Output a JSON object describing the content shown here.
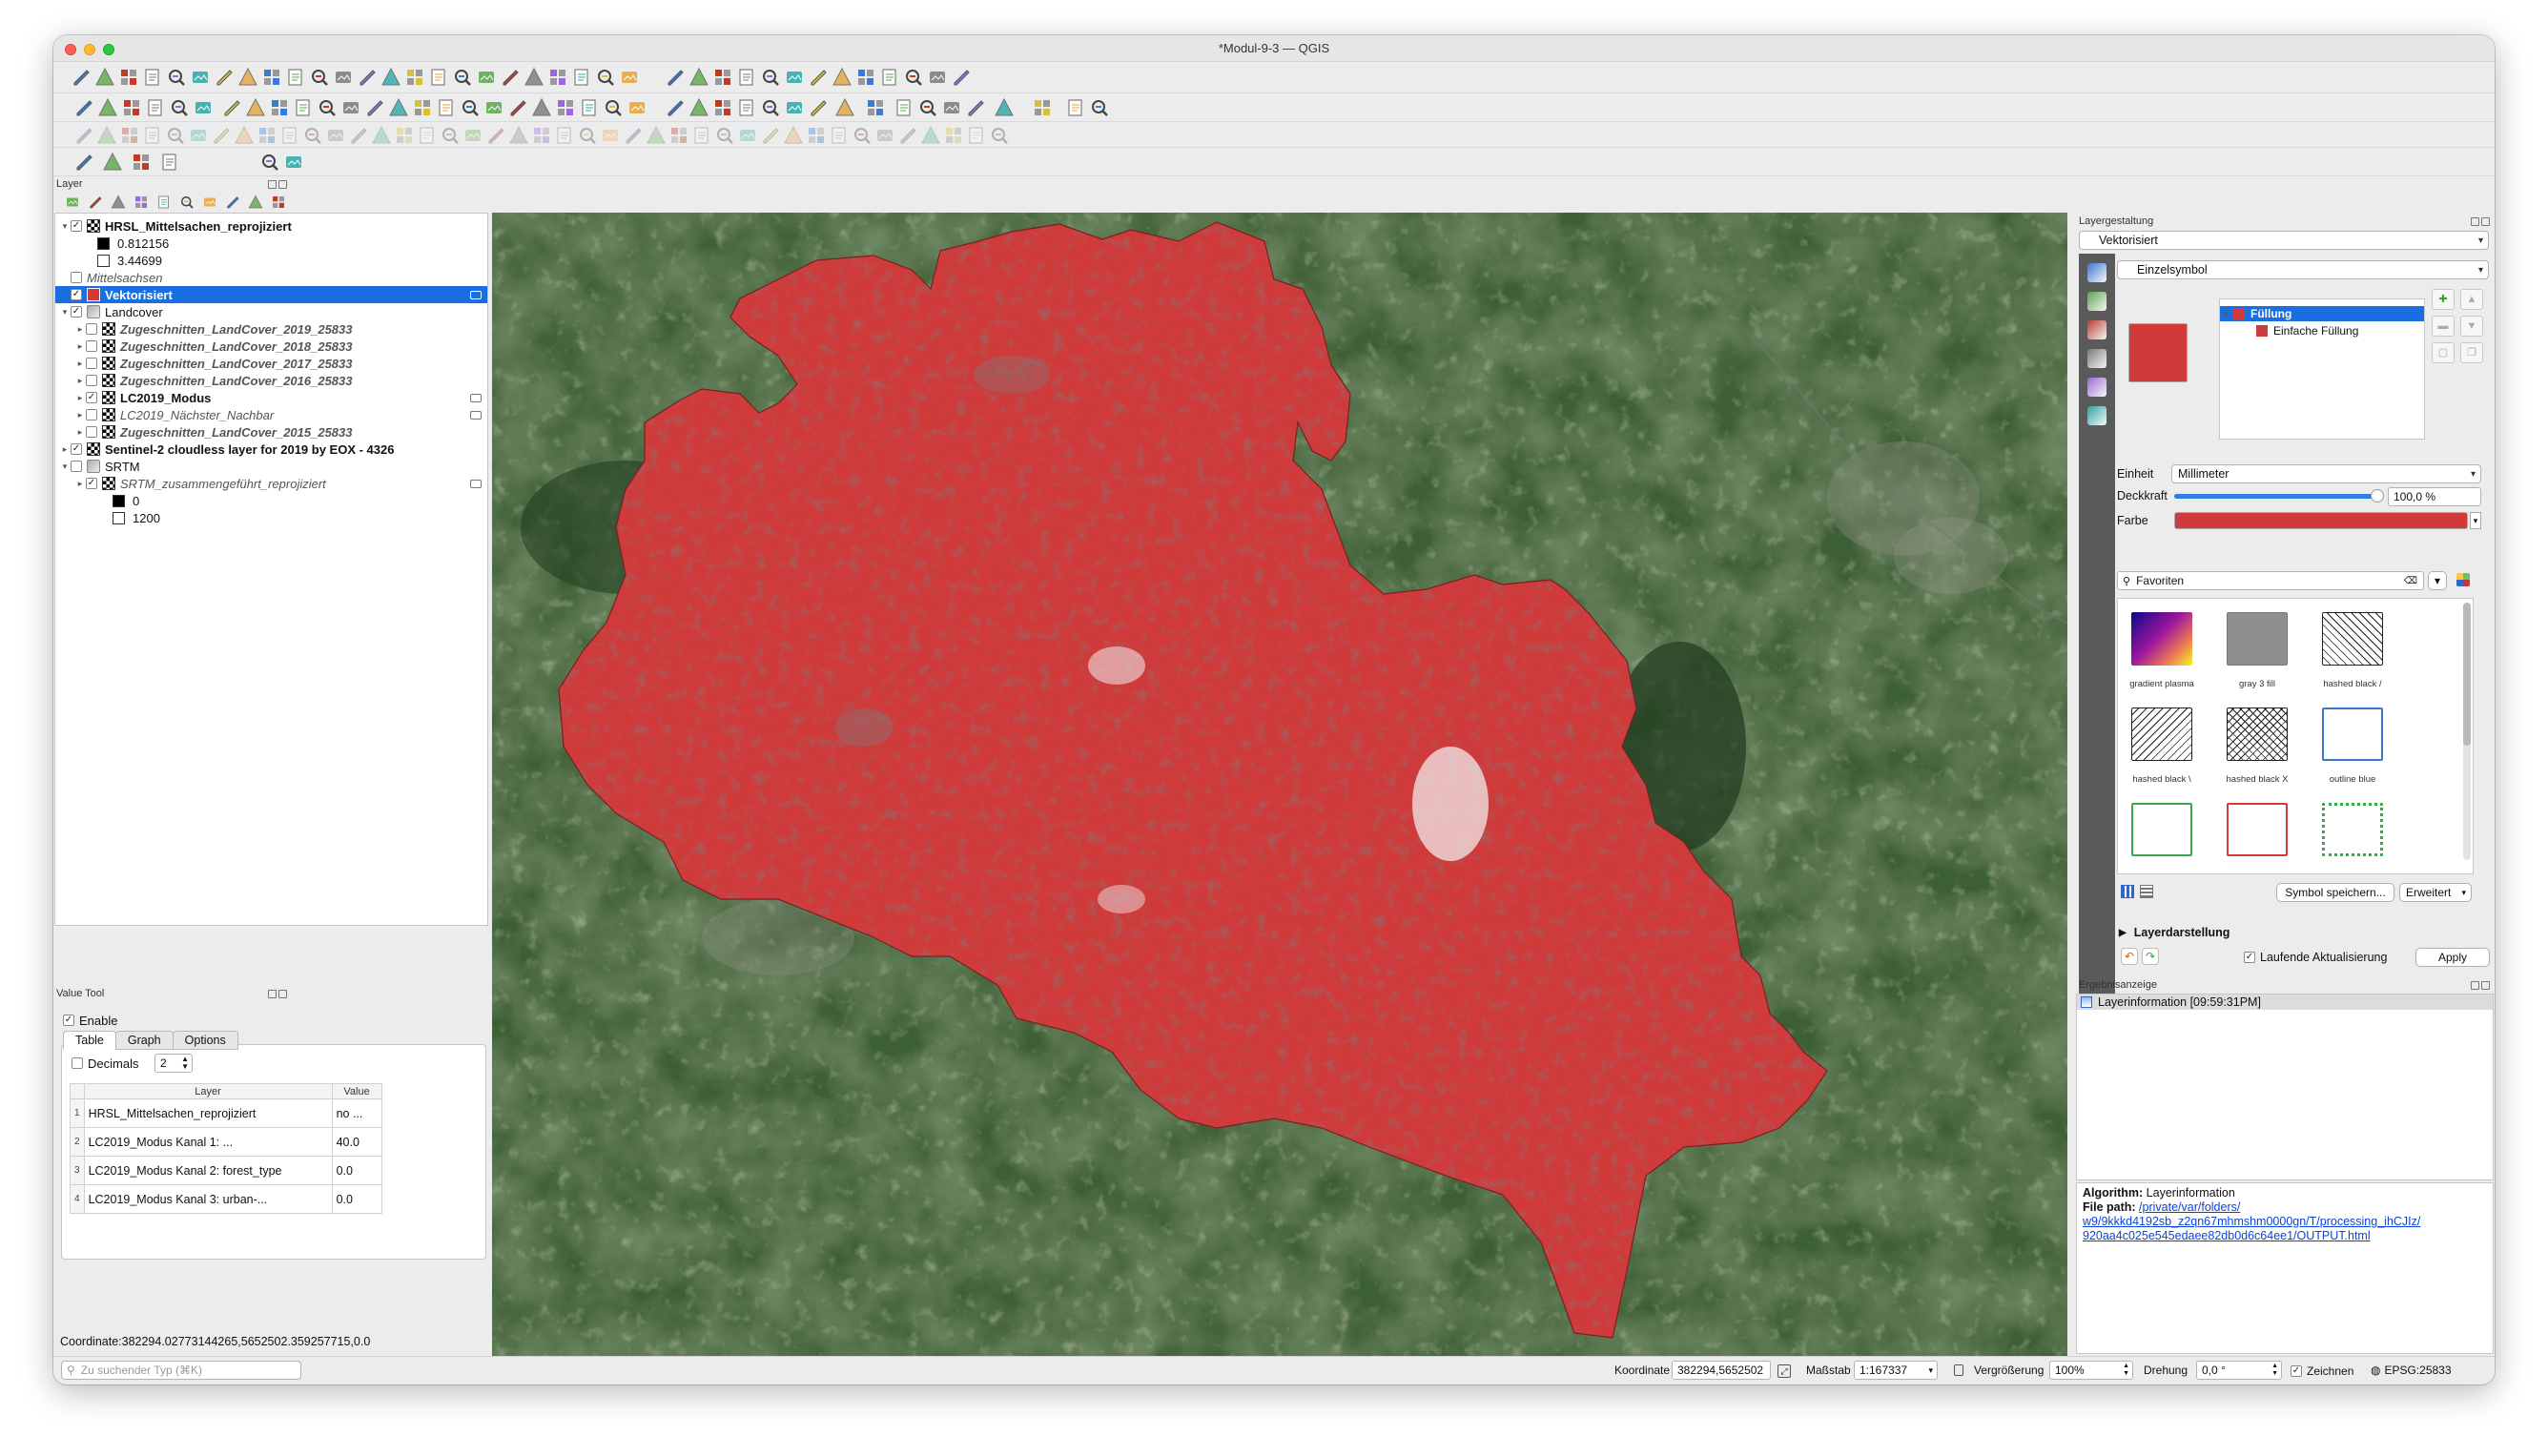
{
  "window": {
    "title": "*Modul-9-3 — QGIS"
  },
  "layers_panel": {
    "title": "Layer",
    "items": [
      {
        "label": "HRSL_Mittelsachen_reprojiziert",
        "style": "bold",
        "checked": true,
        "expanded": true,
        "icon": "raster"
      },
      {
        "label": "0.812156",
        "style": "legend",
        "swatch": "#000000"
      },
      {
        "label": "3.44699",
        "style": "legend",
        "swatch": "#ffffff"
      },
      {
        "label": "Mittelsachsen",
        "style": "italic",
        "checked": false,
        "icon": "none"
      },
      {
        "label": "Vektorisiert",
        "style": "bold",
        "checked": true,
        "selected": true,
        "icon": "polygon"
      },
      {
        "label": "Landcover",
        "style": "group",
        "checked": true,
        "expanded": true,
        "icon": "group"
      },
      {
        "label": "Zugeschnitten_LandCover_2019_25833",
        "style": "italic-bold",
        "checked": false,
        "icon": "raster"
      },
      {
        "label": "Zugeschnitten_LandCover_2018_25833",
        "style": "italic-bold",
        "checked": false,
        "icon": "raster"
      },
      {
        "label": "Zugeschnitten_LandCover_2017_25833",
        "style": "italic-bold",
        "checked": false,
        "icon": "raster"
      },
      {
        "label": "Zugeschnitten_LandCover_2016_25833",
        "style": "italic-bold",
        "checked": false,
        "icon": "raster"
      },
      {
        "label": "LC2019_Modus",
        "style": "bold",
        "checked": true,
        "icon": "raster"
      },
      {
        "label": "LC2019_Nächster_Nachbar",
        "style": "italic",
        "checked": false,
        "icon": "raster"
      },
      {
        "label": "Zugeschnitten_LandCover_2015_25833",
        "style": "italic-bold",
        "checked": false,
        "icon": "raster"
      },
      {
        "label": "Sentinel-2 cloudless layer for 2019 by EOX - 4326",
        "style": "bold",
        "checked": true,
        "icon": "raster"
      },
      {
        "label": "SRTM",
        "style": "group",
        "checked": false,
        "expanded": true,
        "icon": "group"
      },
      {
        "label": "SRTM_zusammengeführt_reprojiziert",
        "style": "italic",
        "checked": true,
        "icon": "raster"
      },
      {
        "label": "0",
        "style": "legend2",
        "swatch": "#000000"
      },
      {
        "label": "1200",
        "style": "legend2",
        "swatch": "#ffffff"
      }
    ]
  },
  "value_tool": {
    "title": "Value Tool",
    "enable_label": "Enable",
    "tabs": [
      "Table",
      "Graph",
      "Options"
    ],
    "decimals_label": "Decimals",
    "decimals_value": "2",
    "col_layer": "Layer",
    "col_value": "Value",
    "rows": [
      {
        "n": "1",
        "layer": "HRSL_Mittelsachen_reprojiziert",
        "value": "no ..."
      },
      {
        "n": "2",
        "layer": "LC2019_Modus Kanal 1: ...",
        "value": "40.0"
      },
      {
        "n": "3",
        "layer": "LC2019_Modus Kanal 2: forest_type",
        "value": "0.0"
      },
      {
        "n": "4",
        "layer": "LC2019_Modus Kanal 3: urban-...",
        "value": "0.0"
      }
    ],
    "coordinate": "Coordinate:382294.02773144265,5652502.359257715,0.0"
  },
  "styling": {
    "title": "Layergestaltung",
    "layer": "Vektorisiert",
    "renderer": "Einzelsymbol",
    "tree_fill": "Füllung",
    "tree_simple": "Einfache Füllung",
    "unit_label": "Einheit",
    "unit_value": "Millimeter",
    "opacity_label": "Deckkraft",
    "opacity_value": "100,0 %",
    "color_label": "Farbe",
    "search_placeholder": "Favoriten",
    "symbols": [
      {
        "label": "gradient  plasma"
      },
      {
        "label": "gray 3 fill"
      },
      {
        "label": "hashed black /"
      },
      {
        "label": "hashed black \\"
      },
      {
        "label": "hashed black X"
      },
      {
        "label": "outline blue"
      },
      {
        "label": ""
      },
      {
        "label": ""
      },
      {
        "label": ""
      }
    ],
    "save_symbol": "Symbol speichern...",
    "advanced": "Erweitert",
    "layer_rendering": "Layerdarstellung",
    "live_update": "Laufende Aktualisierung",
    "apply": "Apply",
    "fill_color": "#d03a3a"
  },
  "results": {
    "title": "Ergebnisanzeige",
    "entry": "Layerinformation [09:59:31PM]",
    "algo_label": "Algorithm:",
    "algo_value": "Layerinformation",
    "path_label": "File path:",
    "path_line1": "/private/var/folders/",
    "path_line2": "w9/9kkkd4192sb_z2qn67mhmshm0000gn/T/processing_ihCJIz/",
    "path_line3": "920aa4c025e545edaee82db0d6c64ee1/OUTPUT.html"
  },
  "statusbar": {
    "search_placeholder": "Zu suchender Typ (⌘K)",
    "coord_label": "Koordinate",
    "coord_value": "382294,5652502",
    "scale_label": "Maßstab",
    "scale_value": "1:167337",
    "mag_label": "Vergrößerung",
    "mag_value": "100%",
    "rot_label": "Drehung",
    "rot_value": "0,0 °",
    "render_label": "Zeichnen",
    "crs": "EPSG:25833"
  }
}
